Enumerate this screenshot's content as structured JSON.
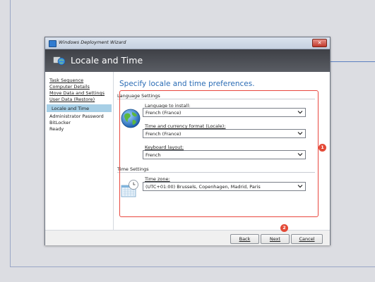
{
  "window": {
    "title": "Windows Deployment Wizard",
    "close_glyph": "✕"
  },
  "header": {
    "title": "Locale and Time"
  },
  "nav": {
    "items": [
      {
        "label": "Task Sequence",
        "type": "link"
      },
      {
        "label": "Computer Details",
        "type": "link"
      },
      {
        "label": "Move Data and Settings",
        "type": "link"
      },
      {
        "label": "User Data (Restore)",
        "type": "link"
      },
      {
        "label": "Locale and Time",
        "type": "selected"
      },
      {
        "label": "Administrator Password",
        "type": "plain"
      },
      {
        "label": "BitLocker",
        "type": "plain"
      },
      {
        "label": "Ready",
        "type": "plain"
      }
    ]
  },
  "main": {
    "heading": "Specify locale and time preferences.",
    "language_group": "Language Settings",
    "language_install": {
      "label": "Language to install:",
      "value": "French (France)"
    },
    "time_currency": {
      "label": "Time and currency format (Locale):",
      "value": "French (France)"
    },
    "keyboard": {
      "label": "Keyboard layout:",
      "value": "French"
    },
    "time_group": "Time Settings",
    "time_zone": {
      "label": "Time zone:",
      "value": "(UTC+01:00) Brussels, Copenhagen, Madrid, Paris"
    }
  },
  "footer": {
    "back": "Back",
    "next": "Next",
    "cancel": "Cancel"
  },
  "callouts": {
    "one": "1",
    "two": "2"
  },
  "colors": {
    "accent": "#2b6cb5",
    "selection": "#a7cfe6",
    "callout": "#e44a37",
    "header": "#4a4c52"
  },
  "icons": [
    "app-icon",
    "locale-header-icon",
    "globe-icon",
    "calendar-clock-icon",
    "chevron-down-icon",
    "close-icon"
  ]
}
